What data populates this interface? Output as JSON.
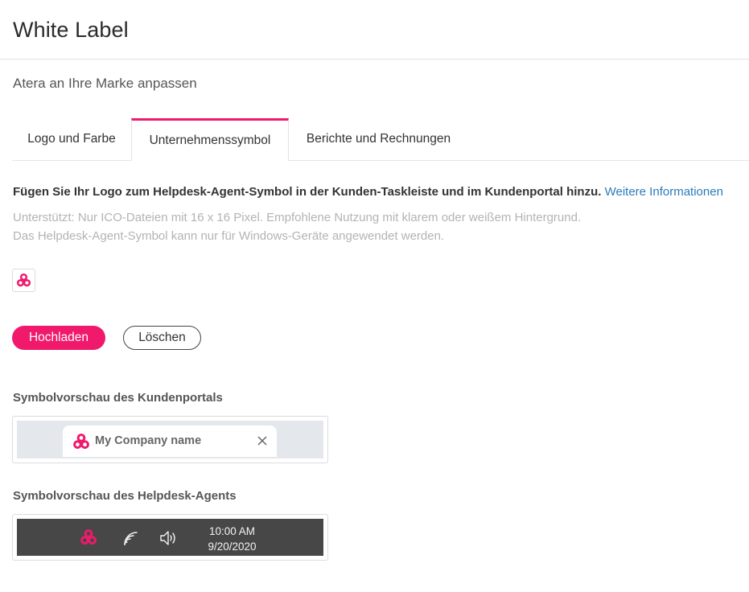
{
  "header": {
    "title": "White Label"
  },
  "subtitle": "Atera an Ihre Marke anpassen",
  "tabs": [
    {
      "label": "Logo und Farbe",
      "active": false
    },
    {
      "label": "Unternehmenssymbol",
      "active": true
    },
    {
      "label": "Berichte und Rechnungen",
      "active": false
    }
  ],
  "content": {
    "intro": "Fügen Sie Ihr Logo zum Helpdesk-Agent-Symbol in der Kunden-Taskleiste und im Kundenportal hinzu.",
    "more_info_link": "Weitere Informationen",
    "hint_line1": "Unterstützt: Nur ICO-Dateien mit 16 x 16 Pixel. Empfohlene Nutzung mit klarem oder weißem Hintergrund.",
    "hint_line2": "Das Helpdesk-Agent-Symbol kann nur für Windows-Geräte angewendet werden."
  },
  "buttons": {
    "upload": "Hochladen",
    "delete": "Löschen"
  },
  "portal_preview": {
    "label": "Symbolvorschau des Kundenportals",
    "tab_title": "My Company name"
  },
  "agent_preview": {
    "label": "Symbolvorschau des Helpdesk-Agents",
    "time": "10:00 AM",
    "date": "9/20/2020"
  },
  "icons": {
    "logo": "atera-logo-icon",
    "close": "close-icon",
    "wifi": "wifi-icon",
    "volume": "speaker-icon"
  },
  "colors": {
    "accent": "#f0196c",
    "link": "#2b7bb9",
    "taskbar": "#474747",
    "portal_bar": "#e4e7eb"
  }
}
